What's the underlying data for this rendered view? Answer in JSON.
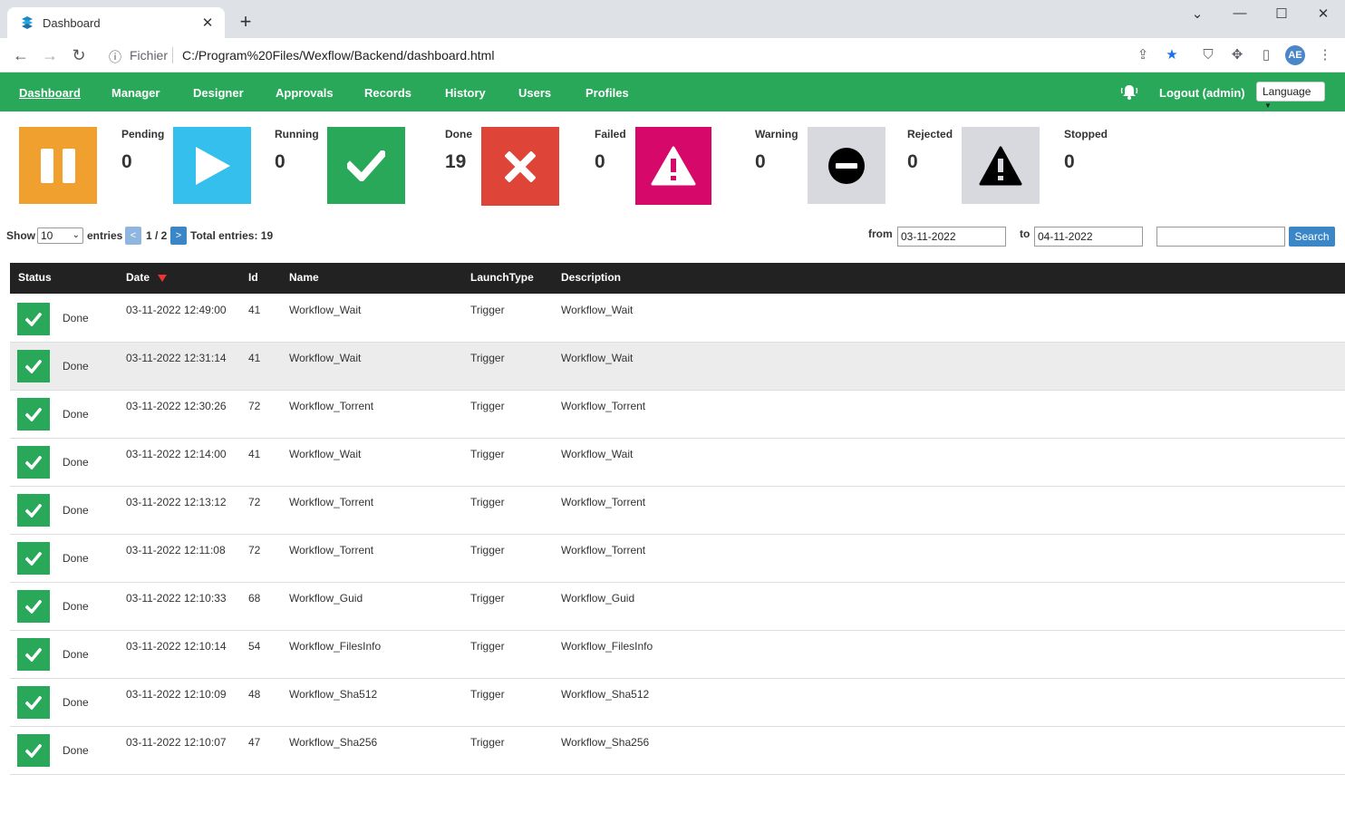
{
  "browser": {
    "tab_title": "Dashboard",
    "url_scheme": "Fichier",
    "url": "C:/Program%20Files/Wexflow/Backend/dashboard.html",
    "avatar_initials": "AE"
  },
  "nav": {
    "items": [
      "Dashboard",
      "Manager",
      "Designer",
      "Approvals",
      "Records",
      "History",
      "Users",
      "Profiles"
    ],
    "logout": "Logout (admin)",
    "language": "Language"
  },
  "stats": [
    {
      "label": "Pending",
      "value": "0",
      "color": "#f0a02e",
      "icon": "pause-icon"
    },
    {
      "label": "Running",
      "value": "0",
      "color": "#35bfec",
      "icon": "play-icon"
    },
    {
      "label": "Done",
      "value": "19",
      "color": "#2aa85a",
      "icon": "check-icon"
    },
    {
      "label": "Failed",
      "value": "0",
      "color": "#de4437",
      "icon": "x-icon"
    },
    {
      "label": "Warning",
      "value": "0",
      "color": "#d6096b",
      "icon": "warning-icon"
    },
    {
      "label": "Rejected",
      "value": "0",
      "color": "#d7d9de",
      "icon": "minus-circle-icon"
    },
    {
      "label": "Stopped",
      "value": "0",
      "color": "#d7d9de",
      "icon": "warning-black-icon"
    }
  ],
  "controls": {
    "show": "Show",
    "entries_select": "10",
    "entries": "entries",
    "prev": "<",
    "page": "1 / 2",
    "next": ">",
    "total": "Total entries: 19",
    "from_label": "from",
    "from_value": "03-11-2022",
    "to_label": "to",
    "to_value": "04-11-2022",
    "search_value": "",
    "search_button": "Search"
  },
  "table": {
    "columns": [
      "Status",
      "Date",
      "Id",
      "Name",
      "LaunchType",
      "Description"
    ],
    "rows": [
      {
        "status": "Done",
        "date": "03-11-2022 12:49:00",
        "id": "41",
        "name": "Workflow_Wait",
        "launch": "Trigger",
        "desc": "Workflow_Wait"
      },
      {
        "status": "Done",
        "date": "03-11-2022 12:31:14",
        "id": "41",
        "name": "Workflow_Wait",
        "launch": "Trigger",
        "desc": "Workflow_Wait"
      },
      {
        "status": "Done",
        "date": "03-11-2022 12:30:26",
        "id": "72",
        "name": "Workflow_Torrent",
        "launch": "Trigger",
        "desc": "Workflow_Torrent"
      },
      {
        "status": "Done",
        "date": "03-11-2022 12:14:00",
        "id": "41",
        "name": "Workflow_Wait",
        "launch": "Trigger",
        "desc": "Workflow_Wait"
      },
      {
        "status": "Done",
        "date": "03-11-2022 12:13:12",
        "id": "72",
        "name": "Workflow_Torrent",
        "launch": "Trigger",
        "desc": "Workflow_Torrent"
      },
      {
        "status": "Done",
        "date": "03-11-2022 12:11:08",
        "id": "72",
        "name": "Workflow_Torrent",
        "launch": "Trigger",
        "desc": "Workflow_Torrent"
      },
      {
        "status": "Done",
        "date": "03-11-2022 12:10:33",
        "id": "68",
        "name": "Workflow_Guid",
        "launch": "Trigger",
        "desc": "Workflow_Guid"
      },
      {
        "status": "Done",
        "date": "03-11-2022 12:10:14",
        "id": "54",
        "name": "Workflow_FilesInfo",
        "launch": "Trigger",
        "desc": "Workflow_FilesInfo"
      },
      {
        "status": "Done",
        "date": "03-11-2022 12:10:09",
        "id": "48",
        "name": "Workflow_Sha512",
        "launch": "Trigger",
        "desc": "Workflow_Sha512"
      },
      {
        "status": "Done",
        "date": "03-11-2022 12:10:07",
        "id": "47",
        "name": "Workflow_Sha256",
        "launch": "Trigger",
        "desc": "Workflow_Sha256"
      }
    ]
  }
}
